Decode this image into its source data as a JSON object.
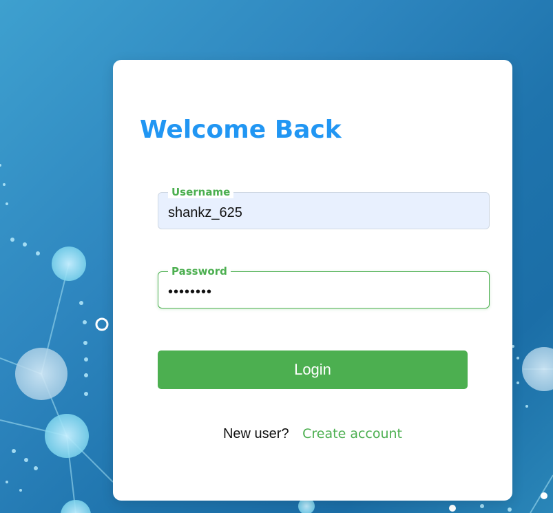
{
  "login": {
    "title": "Welcome Back",
    "username": {
      "label": "Username",
      "value": "shankz_625"
    },
    "password": {
      "label": "Password",
      "value": "abcdefgh"
    },
    "login_button": "Login",
    "signup_prompt": "New user?",
    "signup_link": "Create account"
  },
  "colors": {
    "accent_blue": "#2196f3",
    "accent_green": "#4caf50",
    "autofill_bg": "#e8f0fe",
    "background_blue": "#1f74ad"
  }
}
